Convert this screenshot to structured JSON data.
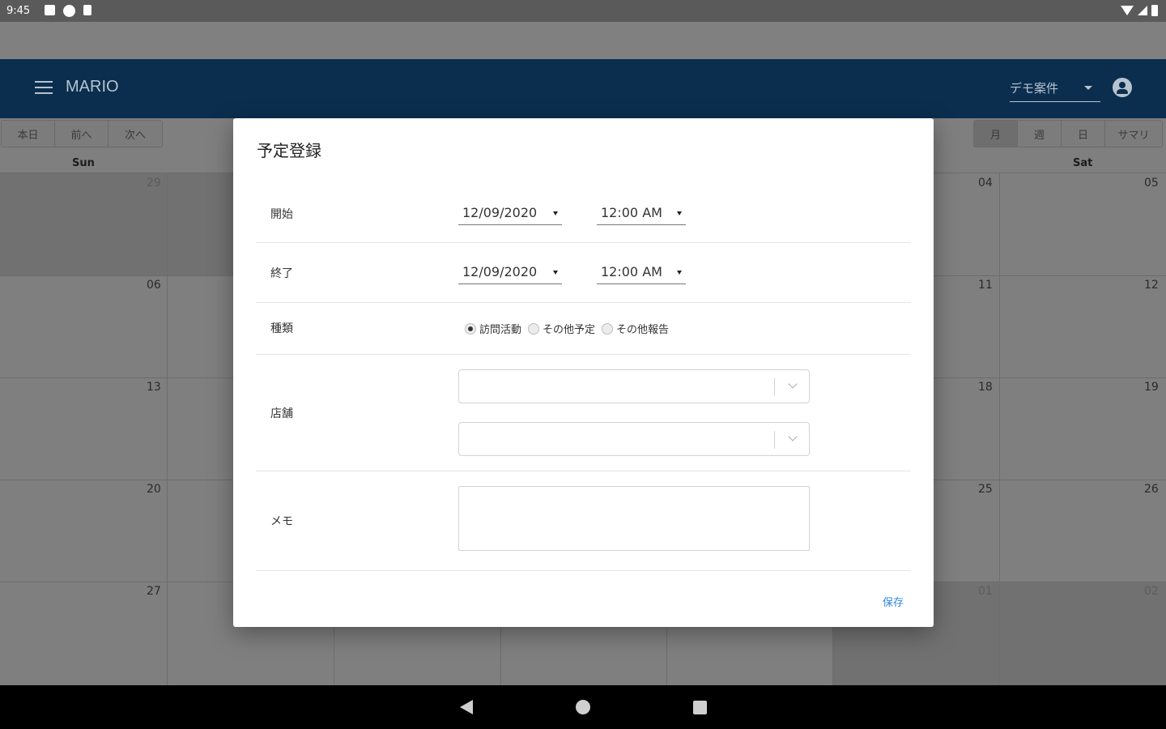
{
  "status_bar": {
    "time": "9:45"
  },
  "app_bar": {
    "title": "MARIO",
    "project_select": "デモ案件"
  },
  "calendar": {
    "nav_left": [
      "本日",
      "前へ",
      "次へ"
    ],
    "view_modes": [
      "月",
      "週",
      "日",
      "サマリ"
    ],
    "active_view": "月",
    "weekday_labels": {
      "sun": "Sun",
      "sat": "Sat"
    },
    "sun_dates": [
      "29",
      "06",
      "13",
      "20",
      "27"
    ],
    "fri_dates": [
      "04",
      "11",
      "18",
      "25",
      "01"
    ],
    "sat_dates": [
      "05",
      "12",
      "19",
      "26",
      "02"
    ]
  },
  "dialog": {
    "title": "予定登録",
    "start": {
      "label": "開始",
      "date": "12/09/2020",
      "time": "12:00 AM"
    },
    "end": {
      "label": "終了",
      "date": "12/09/2020",
      "time": "12:00 AM"
    },
    "type": {
      "label": "種類",
      "options": [
        "訪問活動",
        "その他予定",
        "その他報告"
      ],
      "selected": "訪問活動"
    },
    "store": {
      "label": "店舗"
    },
    "memo": {
      "label": "メモ"
    },
    "save_label": "保存"
  }
}
